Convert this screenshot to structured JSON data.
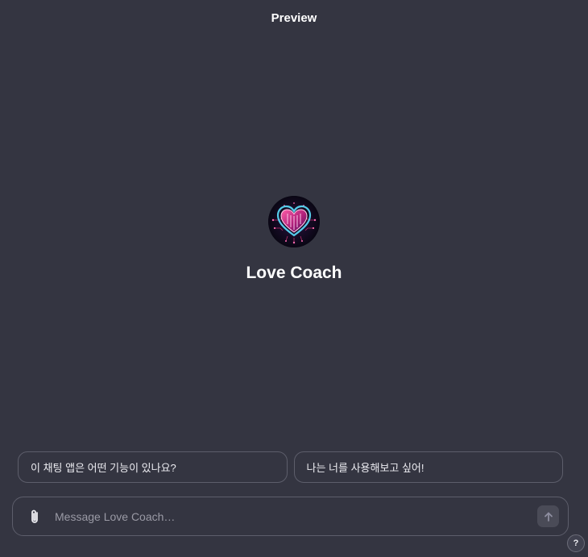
{
  "header": {
    "title": "Preview"
  },
  "gpt": {
    "name": "Love Coach",
    "avatar_icon": "neon-heart-circuit-icon"
  },
  "conversation_starters": [
    {
      "label": "이 채팅 앱은 어떤 기능이 있나요?"
    },
    {
      "label": "나는 너를 사용해보고 싶어!"
    }
  ],
  "composer": {
    "placeholder": "Message Love Coach…",
    "value": "",
    "attach_icon": "paperclip-icon",
    "send_icon": "arrow-up-icon"
  },
  "help": {
    "label": "?"
  },
  "colors": {
    "background": "#343541",
    "border": "#5d5e6b",
    "text": "#ececf1",
    "neon_pink": "#ff3d8b",
    "neon_cyan": "#5ce1ff"
  }
}
